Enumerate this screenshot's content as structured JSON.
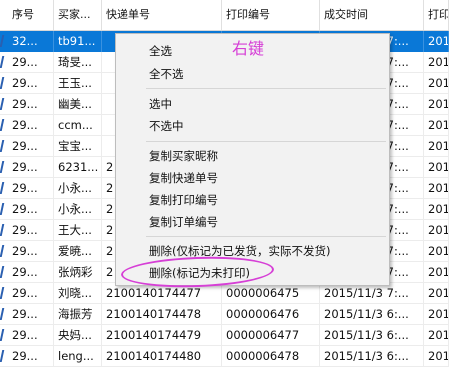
{
  "headers": [
    "序号",
    "买家...",
    "快递单号",
    "打印编号",
    "成交时间",
    "打印"
  ],
  "rows": [
    [
      "32...",
      "tb91...",
      "",
      "",
      "2015/11/3 7:...",
      "201"
    ],
    [
      "29...",
      "琦旻...",
      "",
      "",
      "2015/11/3 7:...",
      "201"
    ],
    [
      "29...",
      "王玉...",
      "",
      "",
      "2015/11/3 7:...",
      "201"
    ],
    [
      "29...",
      "幽美...",
      "",
      "",
      "2015/11/3 7:...",
      "201"
    ],
    [
      "29...",
      "ccm...",
      "",
      "",
      "2015/11/3 7:...",
      "201"
    ],
    [
      "29...",
      "宝宝...",
      "",
      "",
      "2015/11/3 7:...",
      "201"
    ],
    [
      "29...",
      "6231...",
      "2",
      "",
      "2015/11/3 7:...",
      "201"
    ],
    [
      "29...",
      "小永...",
      "2",
      "",
      "2015/11/3 7:...",
      "201"
    ],
    [
      "29...",
      "小永...",
      "2",
      "",
      "2015/11/3 7:...",
      "201"
    ],
    [
      "29...",
      "王大...",
      "2",
      "",
      "2015/11/3 7:...",
      "201"
    ],
    [
      "29...",
      "爱暁...",
      "2",
      "",
      "2015/11/3 7:...",
      "201"
    ],
    [
      "29...",
      "张炳彩",
      "2",
      "",
      "2015/11/3 7:...",
      "201"
    ],
    [
      "29...",
      "刘晓...",
      "2100140174477",
      "0000006475",
      "2015/11/3 7:...",
      "201"
    ],
    [
      "29...",
      "海振芳",
      "2100140174478",
      "0000006476",
      "2015/11/3 6:...",
      "201"
    ],
    [
      "29...",
      "央妈...",
      "2100140174479",
      "0000006477",
      "2015/11/3 6:...",
      "201"
    ],
    [
      "29...",
      "leng...",
      "2100140174480",
      "0000006478",
      "2015/11/3 6:...",
      "201"
    ]
  ],
  "menu": {
    "select_all": "全选",
    "select_none": "全不选",
    "check": "选中",
    "uncheck": "不选中",
    "copy_nick": "复制买家昵称",
    "copy_express": "复制快递单号",
    "copy_print": "复制打印编号",
    "copy_order": "复制订单编号",
    "delete_shipped": "删除(仅标记为已发货，实际不发货)",
    "delete_unprinted": "删除(标记为未打印)"
  },
  "annotation": "右键",
  "colors": {
    "selection": "#0a78d7",
    "annotation": "#d63fd6",
    "menu_bg": "#f2f2f2"
  }
}
